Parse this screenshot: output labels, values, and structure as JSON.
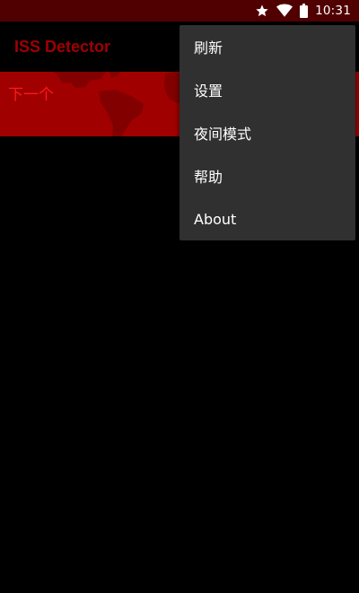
{
  "status_bar": {
    "time": "10:31",
    "icons": [
      "star-icon",
      "wifi-icon",
      "battery-icon"
    ]
  },
  "app_bar": {
    "title": "ISS Detector"
  },
  "banner": {
    "label": "下一个"
  },
  "overflow_menu": {
    "items": [
      {
        "label": "刷新"
      },
      {
        "label": "设置"
      },
      {
        "label": "夜间模式"
      },
      {
        "label": "帮助"
      },
      {
        "label": "About"
      }
    ]
  },
  "colors": {
    "status_bar_bg": "#500000",
    "accent_red": "#a00000",
    "banner_text": "#ff1a1a",
    "menu_bg": "#303030",
    "background": "#000000"
  }
}
